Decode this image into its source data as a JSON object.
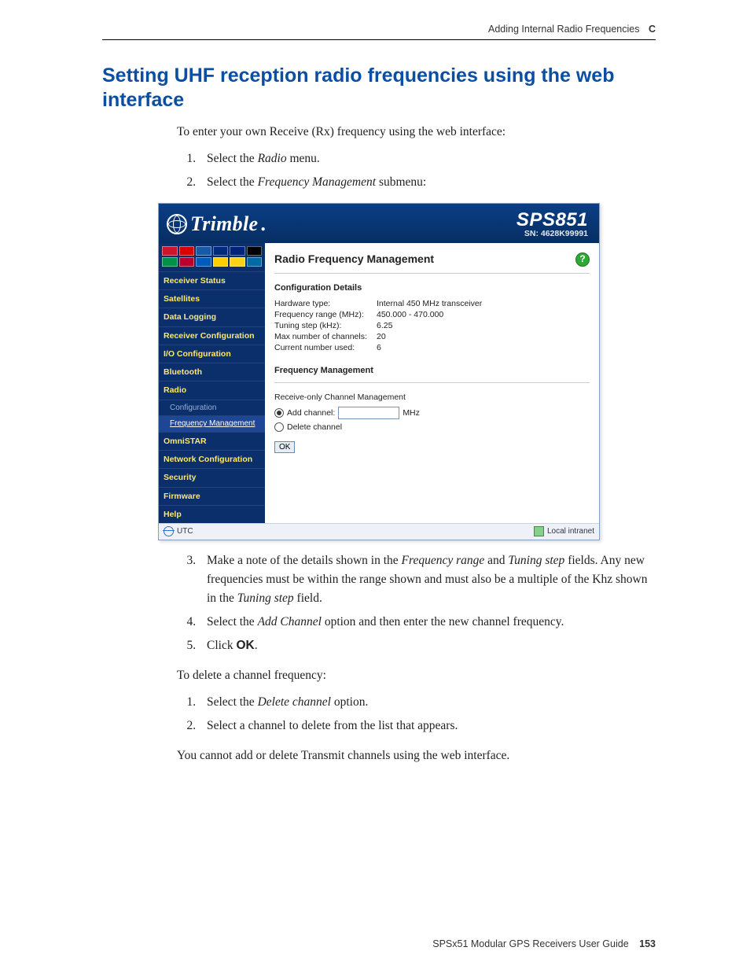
{
  "header": {
    "title": "Adding Internal Radio Frequencies",
    "appendix": "C"
  },
  "section_title": "Setting UHF reception radio frequencies using the web interface",
  "intro": "To enter your own Receive (Rx) frequency using the web interface:",
  "steps_a": [
    {
      "pre": "Select the ",
      "term": "Radio",
      "post": " menu."
    },
    {
      "pre": "Select the ",
      "term": "Frequency Management",
      "post": " submenu:"
    }
  ],
  "steps_b": [
    {
      "pre": "Make a note of the details shown in the ",
      "term": "Frequency range",
      "mid": " and ",
      "term2": "Tuning step",
      "post": " fields. Any new frequencies must be within the range shown and must also be a multiple of the Khz shown in the ",
      "term3": "Tuning step",
      "post2": " field."
    },
    {
      "pre": "Select the ",
      "term": "Add Channel",
      "post": " option and then enter the new channel frequency."
    },
    {
      "pre": "Click ",
      "btn": "OK",
      "post": "."
    }
  ],
  "delete_intro": "To delete a channel frequency:",
  "delete_steps": [
    {
      "pre": "Select the ",
      "term": "Delete channel",
      "post": " option."
    },
    {
      "text": "Select a channel to delete from the list that appears."
    }
  ],
  "note": "You cannot add or delete Transmit channels using the web interface.",
  "footer": {
    "book": "SPSx51 Modular GPS Receivers User Guide",
    "page": "153"
  },
  "app": {
    "brand": "Trimble",
    "model": "SPS851",
    "sn_label": "SN: 4628K99991",
    "flags": [
      "#cf142b",
      "#d00",
      "#175aa8",
      "#002b7f",
      "#00247d",
      "#000",
      "#009246",
      "#bc002d",
      "#005bbf",
      "#ffce00",
      "#fcd116",
      "#006aa7"
    ],
    "nav": [
      {
        "label": "Receiver Status"
      },
      {
        "label": "Satellites"
      },
      {
        "label": "Data Logging"
      },
      {
        "label": "Receiver Configuration"
      },
      {
        "label": "I/O Configuration"
      },
      {
        "label": "Bluetooth"
      },
      {
        "label": "Radio",
        "subs": [
          {
            "label": "Configuration",
            "cls": "dim"
          },
          {
            "label": "Frequency Management",
            "cls": "active"
          }
        ]
      },
      {
        "label": "OmniSTAR"
      },
      {
        "label": "Network Configuration"
      },
      {
        "label": "Security"
      },
      {
        "label": "Firmware"
      },
      {
        "label": "Help"
      }
    ],
    "pane_title": "Radio Frequency Management",
    "config_heading": "Configuration Details",
    "config": [
      {
        "k": "Hardware type:",
        "v": "Internal 450 MHz transceiver"
      },
      {
        "k": "Frequency range (MHz):",
        "v": "450.000 - 470.000"
      },
      {
        "k": "Tuning step (kHz):",
        "v": "6.25"
      },
      {
        "k": "Max number of channels:",
        "v": "20"
      },
      {
        "k": "Current number used:",
        "v": "6"
      }
    ],
    "fm_heading": "Frequency Management",
    "fm_sub": "Receive-only Channel Management",
    "add_label": "Add channel:",
    "mhz": "MHz",
    "del_label": "Delete channel",
    "ok": "OK",
    "status_left": "UTC",
    "status_right": "Local intranet"
  }
}
